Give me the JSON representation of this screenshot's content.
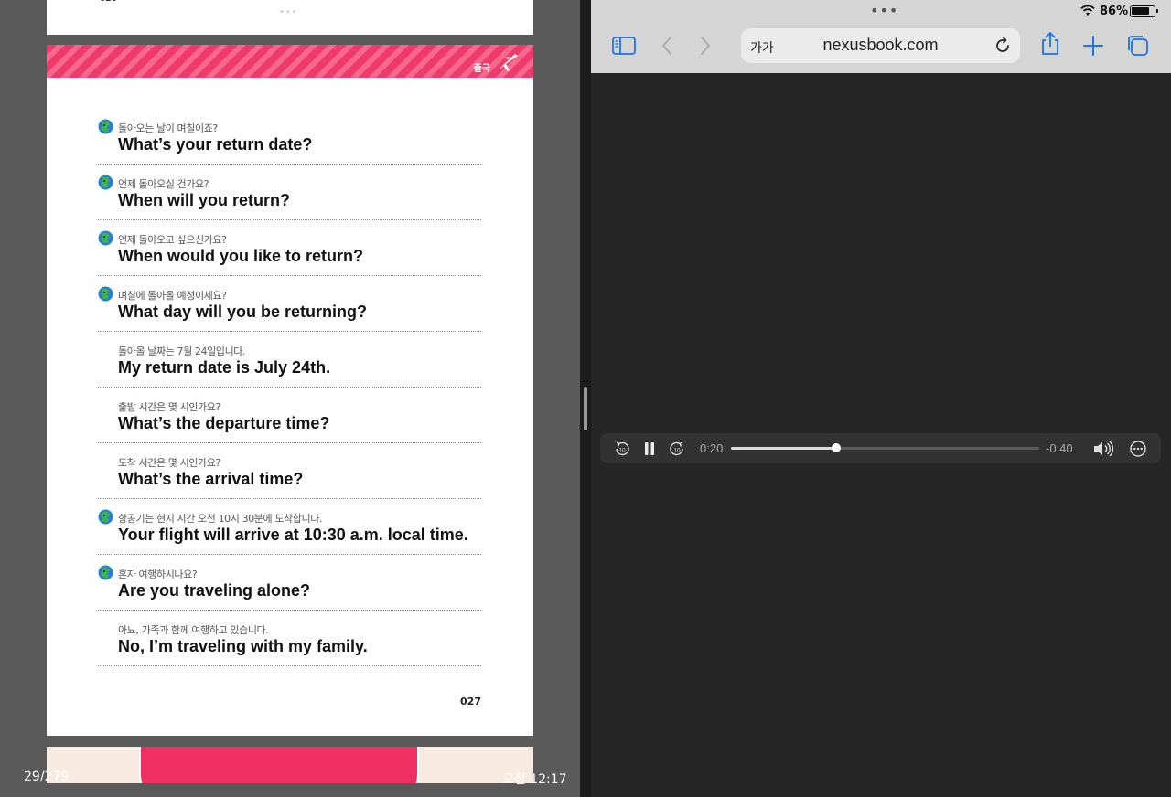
{
  "reader": {
    "prev_page_number": "026",
    "section_label": "출국",
    "page_number": "027",
    "progress": "29/279",
    "clock": "오전 12:17",
    "entries": [
      {
        "ko": "돌아오는 날이 며칠이죠?",
        "en": "What’s your return date?",
        "badge": true
      },
      {
        "ko": "언제 돌아오실 건가요?",
        "en": "When will you return?",
        "badge": true
      },
      {
        "ko": "언제 돌아오고 싶으신가요?",
        "en": "When would you like to return?",
        "badge": true
      },
      {
        "ko": "며칠에 돌아올 예정이세요?",
        "en": "What day will you be returning?",
        "badge": true
      },
      {
        "ko": "돌아올 날짜는 7월 24일입니다.",
        "en": "My return date is July 24th.",
        "badge": false
      },
      {
        "ko": "출발 시간은 몇 시인가요?",
        "en": "What’s the departure time?",
        "badge": false
      },
      {
        "ko": "도착 시간은 몇 시인가요?",
        "en": "What’s the arrival time?",
        "badge": false
      },
      {
        "ko": "항공기는 현지 시간 오전 10시 30분에 도착합니다.",
        "en": "Your flight will arrive at 10:30 a.m. local time.",
        "badge": true
      },
      {
        "ko": "혼자 여행하시나요?",
        "en": "Are you traveling alone?",
        "badge": true
      },
      {
        "ko": "아뇨, 가족과 함께 여행하고 있습니다.",
        "en": "No, I’m traveling with my family.",
        "badge": false
      }
    ]
  },
  "browser": {
    "battery_percent": "86%",
    "battery_level": 0.86,
    "text_size_label": "가가",
    "url": "nexusbook.com",
    "icons": [
      "sidebar-icon",
      "back-icon",
      "forward-icon",
      "reload-icon",
      "share-icon",
      "new-tab-icon",
      "tabs-icon"
    ]
  },
  "player": {
    "elapsed": "0:20",
    "remaining": "-0:40",
    "progress_fraction": 0.34,
    "icons": [
      "skip-back-10-icon",
      "pause-icon",
      "skip-forward-10-icon",
      "volume-icon",
      "more-icon"
    ]
  },
  "colors": {
    "banner_pink": "#ef3a6b",
    "badge_green": "#3cb44a",
    "badge_blue": "#2a7fd4",
    "safari_blue": "#1a73e8"
  }
}
